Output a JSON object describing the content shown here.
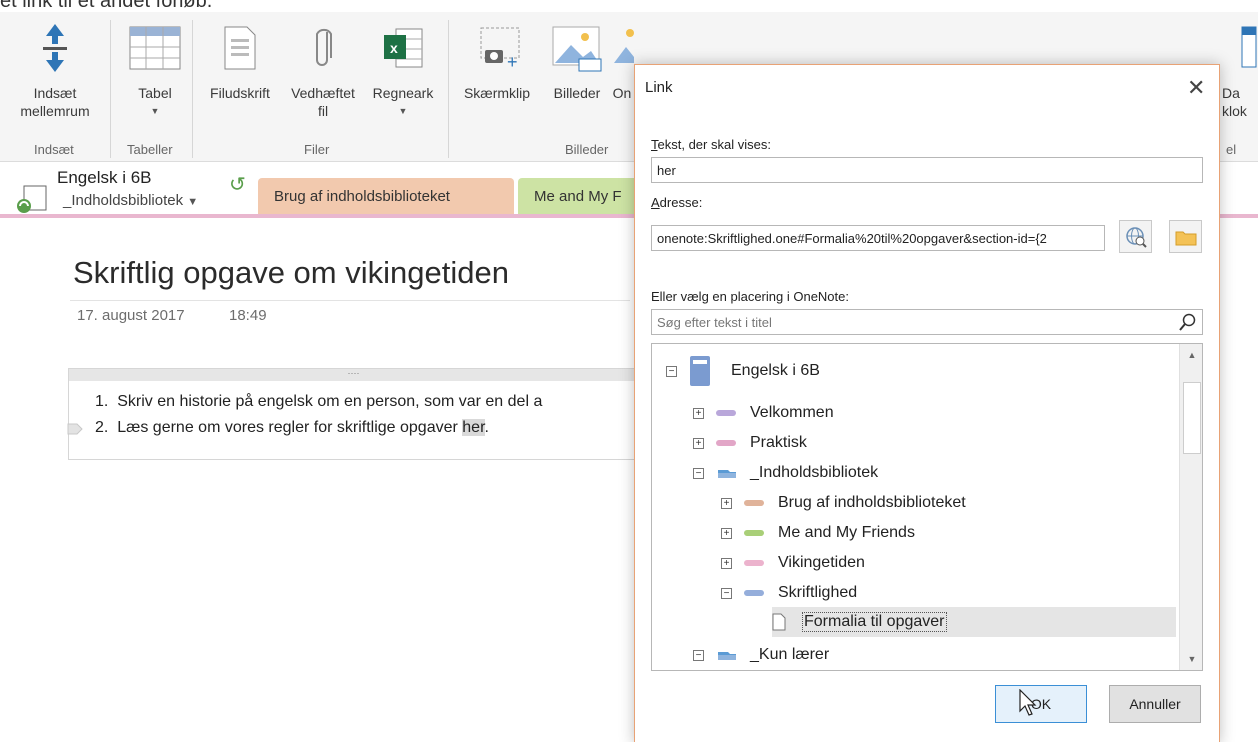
{
  "caption": "et link til et andet forløb.",
  "ribbon": {
    "buttons": {
      "insert_space": "Indsæt\nmellemrum",
      "table": "Tabel",
      "file_printout": "Filudskrift",
      "attachment": "Vedhæftet\nfil",
      "spreadsheet": "Regneark",
      "screen_clip": "Skærmklip",
      "pictures": "Billeder",
      "online_partial": "On",
      "partial_right_1": "t",
      "partial_right_2": "Da\nklok"
    },
    "groups": {
      "insert": "Indsæt",
      "tables": "Tabeller",
      "files": "Filer",
      "images": "Billeder",
      "partial_right": "el"
    }
  },
  "notebook": {
    "name": "Engelsk i 6B",
    "section": "_Indholdsbibliotek",
    "tabs": [
      "Brug af indholdsbiblioteket",
      "Me and My F"
    ],
    "colors": {
      "tab_brug": "#f2c9ae",
      "tab_me": "#cde3a4",
      "accent_line": "#e9b7cf"
    }
  },
  "page": {
    "title": "Skriftlig opgave om vikingetiden",
    "date": "17. august 2017",
    "time": "18:49",
    "list": [
      {
        "num": "1.",
        "text": "Skriv en historie på engelsk om en person, som var en del a"
      },
      {
        "num": "2.",
        "text": "Læs gerne om vores regler for skriftlige opgaver ",
        "link": "her",
        "end": "."
      }
    ]
  },
  "dialog": {
    "title": "Link",
    "text_label_u": "T",
    "text_label": "ekst, der skal vises:",
    "text_value": "her",
    "address_label_u": "A",
    "address_label": "dresse:",
    "address_value": "onenote:Skriftlighed.one#Formalia%20til%20opgaver&section-id={2",
    "location_label": "Eller vælg en placering i OneNote:",
    "search_placeholder": "Søg efter tekst i titel",
    "tree": [
      {
        "label": "Engelsk i 6B",
        "type": "notebook",
        "exp": "−"
      },
      {
        "label": "Velkommen",
        "type": "section",
        "exp": "+",
        "color": "#b9a7da"
      },
      {
        "label": "Praktisk",
        "type": "section",
        "exp": "+",
        "color": "#e2a6c7"
      },
      {
        "label": "_Indholdsbibliotek",
        "type": "group",
        "exp": "−"
      },
      {
        "label": "Brug af indholdsbiblioteket",
        "type": "section",
        "exp": "+",
        "color": "#e0b39a"
      },
      {
        "label": "Me and My Friends",
        "type": "section",
        "exp": "+",
        "color": "#a9cf78"
      },
      {
        "label": "Vikingetiden",
        "type": "section",
        "exp": "+",
        "color": "#ecb3cd"
      },
      {
        "label": "Skriftlighed",
        "type": "section",
        "exp": "−",
        "color": "#95aedb"
      },
      {
        "label": "Formalia til opgaver",
        "type": "page",
        "exp": ""
      },
      {
        "label": "_Kun lærer",
        "type": "group",
        "exp": "−"
      }
    ],
    "ok": "OK",
    "cancel": "Annuller"
  }
}
